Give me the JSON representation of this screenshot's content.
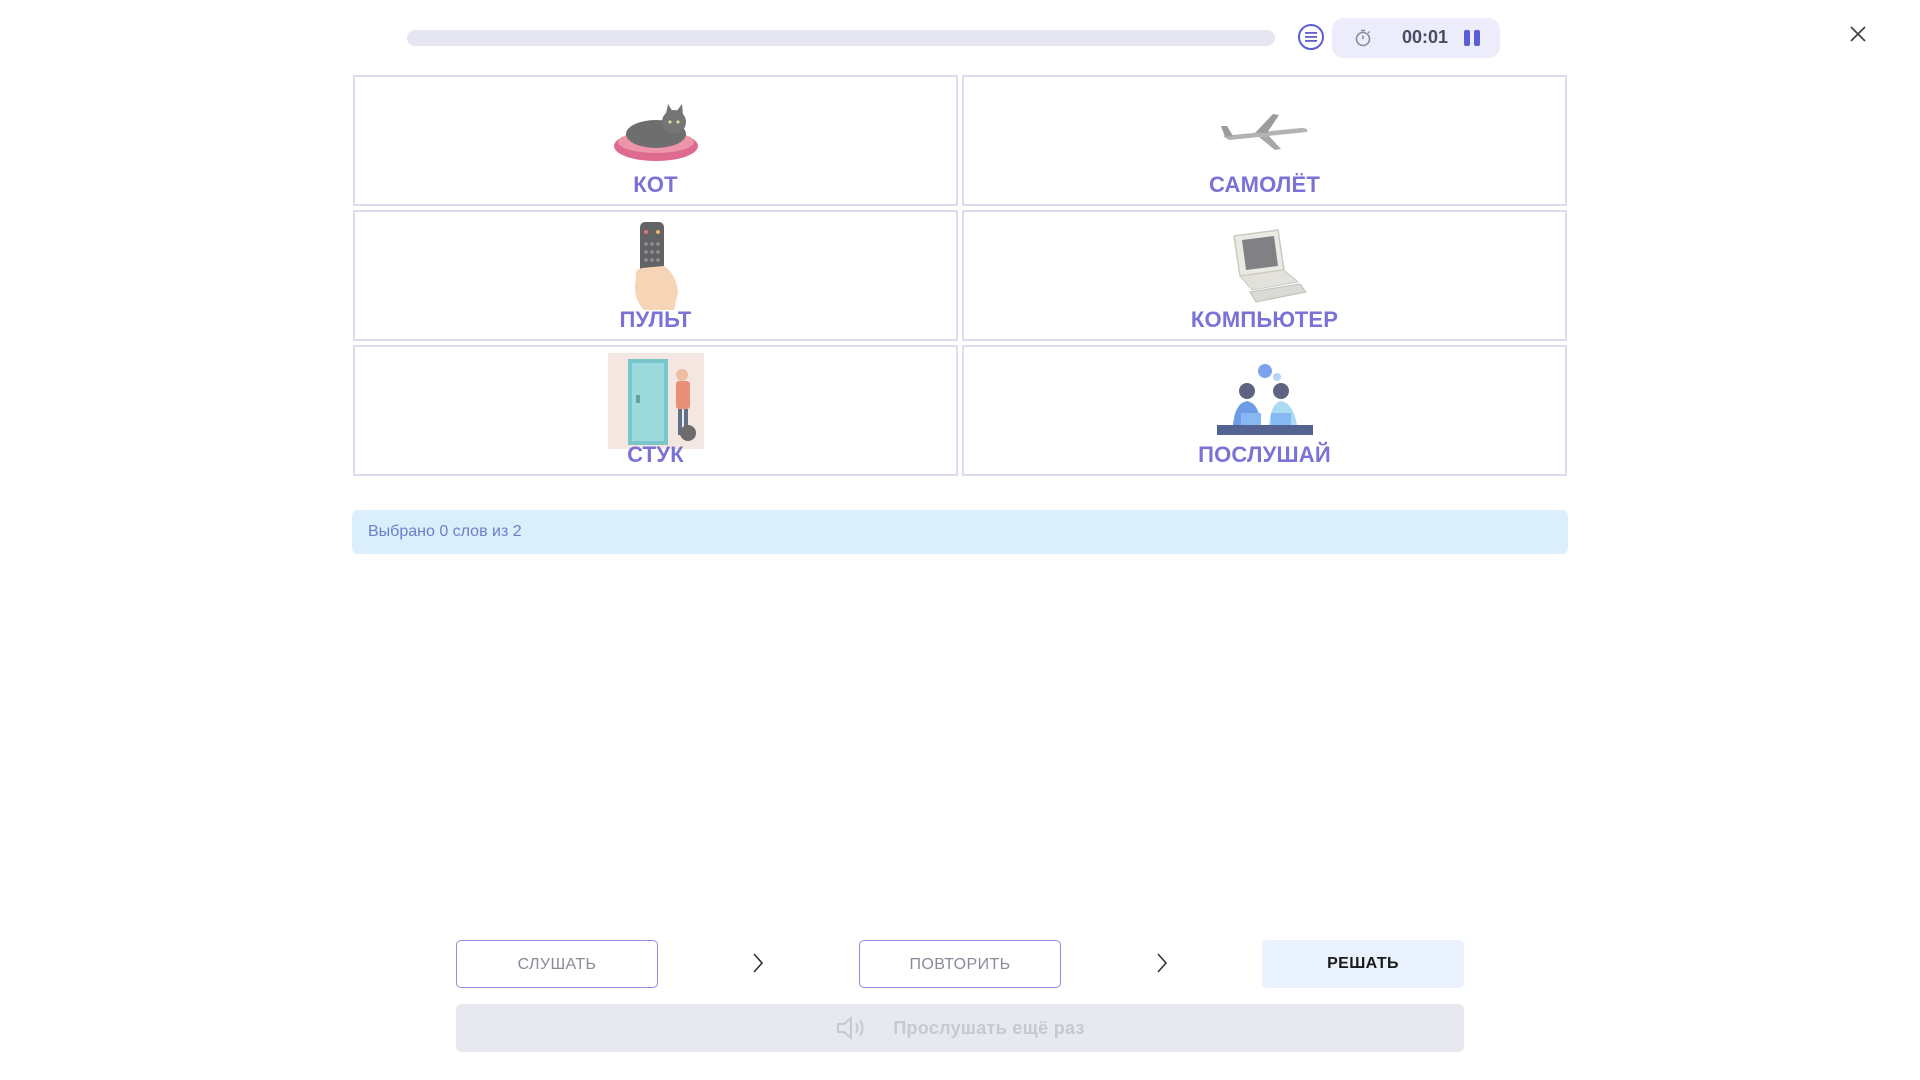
{
  "header": {
    "progress_percent": 0,
    "timer": "00:01",
    "list_icon": "list-icon",
    "stopwatch_icon": "stopwatch-icon",
    "pause_icon": "pause-icon",
    "close_icon": "close-icon"
  },
  "cards": [
    {
      "label": "КОТ",
      "icon": "cat-on-cushion-image"
    },
    {
      "label": "САМОЛЁТ",
      "icon": "airplane-image"
    },
    {
      "label": "ПУЛЬТ",
      "icon": "remote-control-image"
    },
    {
      "label": "КОМПЬЮТЕР",
      "icon": "computer-image"
    },
    {
      "label": "СТУК",
      "icon": "knock-door-image"
    },
    {
      "label": "ПОСЛУШАЙ",
      "icon": "people-talking-image"
    }
  ],
  "info": {
    "text": "Выбрано 0 слов из 2"
  },
  "controls": {
    "listen_label": "СЛУШАТЬ",
    "repeat_label": "ПОВТОРИТЬ",
    "solve_label": "РЕШАТЬ",
    "replay_label": "Прослушать ещё раз",
    "chevron_icon": "chevron-right-icon",
    "speaker_icon": "speaker-icon"
  },
  "colors": {
    "accent": "#5c5fd0",
    "card_label": "#7a72d6",
    "info_bg": "#daeefc",
    "info_text": "#6a7fc9",
    "solve_bg": "#eaf3fd"
  }
}
